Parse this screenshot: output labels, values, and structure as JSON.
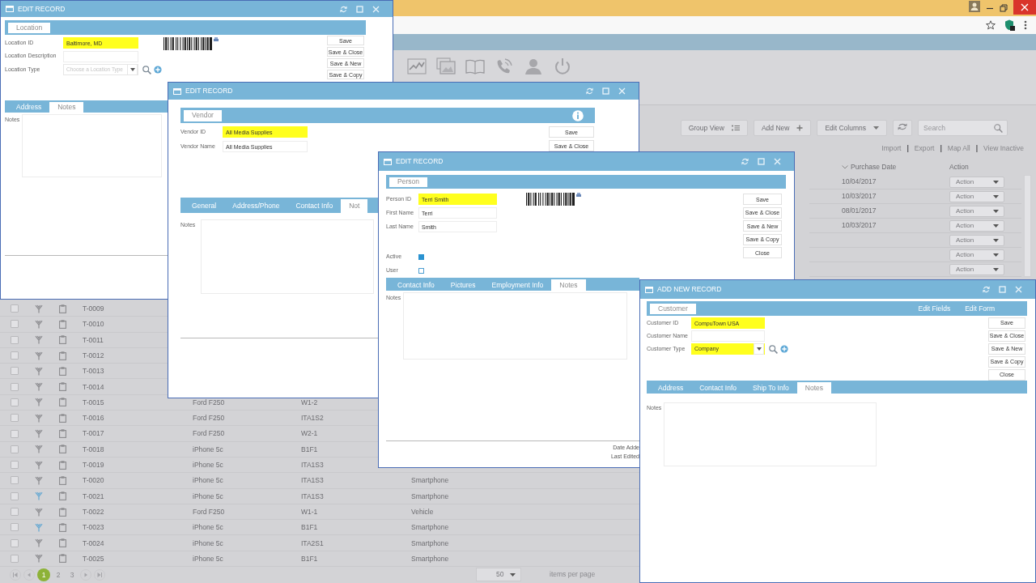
{
  "app": {
    "grid_toolbar": {
      "buttons": [
        {
          "kind": "group",
          "label": "Group View"
        },
        {
          "kind": "add",
          "label": "Add New"
        },
        {
          "kind": "columns",
          "label": "Edit Columns"
        }
      ],
      "search": {
        "placeholder": "Search"
      }
    },
    "grid_links": [
      {
        "kind": "link",
        "label": "Import"
      },
      {
        "kind": "separator",
        "label": "|"
      },
      {
        "kind": "link",
        "label": "Export"
      },
      {
        "kind": "separator",
        "label": "|"
      },
      {
        "kind": "link",
        "label": "Map All"
      },
      {
        "kind": "separator",
        "label": "|"
      },
      {
        "kind": "link",
        "label": "View Inactive"
      }
    ],
    "columns": [
      {
        "label": "Purchase Date",
        "sorted": true
      },
      {
        "label": "Action",
        "sorted": false
      }
    ],
    "upper_rows": [
      {
        "purchase_date": "10/04/2017",
        "action": "Action"
      },
      {
        "purchase_date": "10/03/2017",
        "action": "Action"
      },
      {
        "purchase_date": "08/01/2017",
        "action": "Action"
      },
      {
        "purchase_date": "10/03/2017",
        "action": "Action"
      },
      {
        "action": "Action"
      },
      {
        "action": "Action"
      },
      {
        "action": "Action"
      }
    ],
    "rows": [
      {
        "checked": false,
        "color": "#8e8e92",
        "id": "T-0009"
      },
      {
        "checked": false,
        "color": "#8e8e92",
        "id": "T-0010"
      },
      {
        "checked": false,
        "color": "#8e8e92",
        "id": "T-0011"
      },
      {
        "checked": false,
        "color": "#8e8e92",
        "id": "T-0012"
      },
      {
        "checked": false,
        "color": "#8e8e92",
        "id": "T-0013"
      },
      {
        "checked": false,
        "color": "#8e8e92",
        "id": "T-0014"
      },
      {
        "checked": false,
        "color": "#8e8e92",
        "id": "T-0015",
        "model": "Ford F250",
        "location": "W1-2"
      },
      {
        "checked": false,
        "color": "#8e8e92",
        "id": "T-0016",
        "model": "Ford F250",
        "location": "ITA1S2"
      },
      {
        "checked": false,
        "color": "#8e8e92",
        "id": "T-0017",
        "model": "Ford F250",
        "location": "W2-1"
      },
      {
        "checked": false,
        "color": "#8e8e92",
        "id": "T-0018",
        "model": "iPhone 5c",
        "location": "B1F1"
      },
      {
        "checked": false,
        "color": "#8e8e92",
        "id": "T-0019",
        "model": "iPhone 5c",
        "location": "ITA1S3"
      },
      {
        "checked": false,
        "color": "#8e8e92",
        "id": "T-0020",
        "model": "iPhone 5c",
        "location": "ITA1S3",
        "type": "Smartphone"
      },
      {
        "checked": false,
        "color": "#6aaad2",
        "id": "T-0021",
        "model": "iPhone 5c",
        "location": "ITA1S3",
        "type": "Smartphone"
      },
      {
        "checked": false,
        "color": "#8e8e92",
        "id": "T-0022",
        "model": "Ford F250",
        "location": "W1-1",
        "type": "Vehicle"
      },
      {
        "checked": false,
        "color": "#6aaad2",
        "id": "T-0023",
        "model": "iPhone 5c",
        "location": "B1F1",
        "type": "Smartphone"
      },
      {
        "checked": false,
        "color": "#8e8e92",
        "id": "T-0024",
        "model": "iPhone 5c",
        "location": "ITA2S1",
        "type": "Smartphone"
      },
      {
        "checked": false,
        "color": "#8e8e92",
        "id": "T-0025",
        "model": "iPhone 5c",
        "location": "B1F1",
        "type": "Smartphone"
      }
    ],
    "pager": {
      "pages": [
        {
          "label": "1",
          "selected": true
        },
        {
          "label": "2",
          "selected": false
        },
        {
          "label": "3",
          "selected": false
        }
      ],
      "page_size": "50",
      "page_size_label": "items per page"
    }
  },
  "windows": [
    {
      "title": "EDIT RECORD",
      "panel_tab": "Location",
      "barcode": true,
      "fields": [
        {
          "kind": "text",
          "label": "Location ID",
          "value": "Baltimore, MD",
          "highlighted": true
        },
        {
          "kind": "text",
          "label": "Location Description",
          "highlighted": false
        },
        {
          "kind": "select",
          "label": "Location Type",
          "placeholder": "Choose a Location Type",
          "highlighted": false
        }
      ],
      "buttons": [
        "Save",
        "Save & Close",
        "Save & New",
        "Save & Copy"
      ],
      "tabs": [
        {
          "label": "Address",
          "selected": false
        },
        {
          "label": "Notes",
          "selected": true
        }
      ],
      "notes_label": "Notes"
    },
    {
      "title": "EDIT RECORD",
      "panel_tab": "Vendor",
      "info_button": true,
      "fields": [
        {
          "kind": "text",
          "label": "Vendor ID",
          "value": "All Media Supplies",
          "highlighted": true
        },
        {
          "kind": "text",
          "label": "Vendor Name",
          "value": "All Media Supplies",
          "highlighted": false
        }
      ],
      "buttons": [
        "Save",
        "Save & Close"
      ],
      "tabs": [
        {
          "label": "General",
          "selected": false
        },
        {
          "label": "Address/Phone",
          "selected": false
        },
        {
          "label": "Contact Info",
          "selected": false
        },
        {
          "label": "Not",
          "selected": true
        }
      ],
      "notes_label": "Notes"
    },
    {
      "title": "EDIT RECORD",
      "panel_tab": "Person",
      "barcode": true,
      "fields": [
        {
          "kind": "text",
          "label": "Person ID",
          "value": "Terri Smith",
          "highlighted": true
        },
        {
          "kind": "text",
          "label": "First Name",
          "value": "Terri",
          "highlighted": false
        },
        {
          "kind": "text",
          "label": "Last Name",
          "value": "Smith",
          "highlighted": false
        },
        {
          "kind": "checkbox",
          "label": "Active",
          "checked": true
        },
        {
          "kind": "checkbox",
          "label": "User",
          "checked": false
        }
      ],
      "buttons": [
        "Save",
        "Save & Close",
        "Save & New",
        "Save & Copy",
        "Close"
      ],
      "tabs": [
        {
          "label": "Contact Info",
          "selected": false
        },
        {
          "label": "Pictures",
          "selected": false
        },
        {
          "label": "Employment Info",
          "selected": false
        },
        {
          "label": "Notes",
          "selected": true
        }
      ],
      "notes_label": "Notes",
      "footer": [
        "Date Adde",
        "Last Edited"
      ]
    },
    {
      "title": "ADD NEW RECORD",
      "panel_tab": "Customer",
      "panel_links": [
        "Edit Fields",
        "Edit Form"
      ],
      "fields": [
        {
          "kind": "text",
          "label": "Customer ID",
          "value": "CompuTown USA",
          "highlighted": true
        },
        {
          "kind": "text",
          "label": "Customer Name",
          "highlighted": false
        },
        {
          "kind": "select",
          "label": "Customer Type",
          "value": "Company",
          "highlighted": true
        }
      ],
      "buttons": [
        "Save",
        "Save & Close",
        "Save & New",
        "Save & Copy",
        "Close"
      ],
      "tabs": [
        {
          "label": "Address",
          "selected": false
        },
        {
          "label": "Contact Info",
          "selected": false
        },
        {
          "label": "Ship To Info",
          "selected": false
        },
        {
          "label": "Notes",
          "selected": true
        }
      ],
      "notes_label": "Notes"
    }
  ]
}
